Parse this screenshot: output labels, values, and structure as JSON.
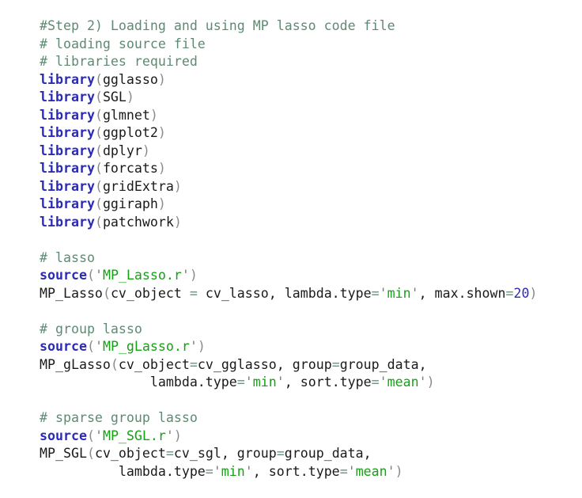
{
  "document": {
    "kind": "r-code-snippet",
    "language": "R",
    "background_color": "#ffffff"
  },
  "colors": {
    "comment": "#5e8a73",
    "keyword": "#2b2bb5",
    "string": "#16a016",
    "quote": "#7a7a7a",
    "paren": "#8a8a8a",
    "plain": "#1a1a1a",
    "number": "#2b2bb5",
    "operator": "#6f8f7f"
  },
  "code": {
    "lines": [
      {
        "id": "line-1",
        "type": "comment",
        "text": "#Step 2) Loading and using MP lasso code file",
        "tokens": [
          {
            "t": "#Step 2) Loading and using MP lasso code file",
            "c": "tok-comment"
          }
        ]
      },
      {
        "id": "line-2",
        "type": "comment",
        "text": "# loading source file",
        "tokens": [
          {
            "t": "# loading source file",
            "c": "tok-comment"
          }
        ]
      },
      {
        "id": "line-3",
        "type": "comment",
        "text": "# libraries required",
        "tokens": [
          {
            "t": "# libraries required",
            "c": "tok-comment"
          }
        ]
      },
      {
        "id": "line-4",
        "type": "code",
        "text": "library(gglasso)",
        "tokens": [
          {
            "t": "library",
            "c": "tok-keyword"
          },
          {
            "t": "(",
            "c": "tok-paren"
          },
          {
            "t": "gglasso",
            "c": "tok-plain"
          },
          {
            "t": ")",
            "c": "tok-paren"
          }
        ]
      },
      {
        "id": "line-5",
        "type": "code",
        "text": "library(SGL)",
        "tokens": [
          {
            "t": "library",
            "c": "tok-keyword"
          },
          {
            "t": "(",
            "c": "tok-paren"
          },
          {
            "t": "SGL",
            "c": "tok-plain"
          },
          {
            "t": ")",
            "c": "tok-paren"
          }
        ]
      },
      {
        "id": "line-6",
        "type": "code",
        "text": "library(glmnet)",
        "tokens": [
          {
            "t": "library",
            "c": "tok-keyword"
          },
          {
            "t": "(",
            "c": "tok-paren"
          },
          {
            "t": "glmnet",
            "c": "tok-plain"
          },
          {
            "t": ")",
            "c": "tok-paren"
          }
        ]
      },
      {
        "id": "line-7",
        "type": "code",
        "text": "library(ggplot2)",
        "tokens": [
          {
            "t": "library",
            "c": "tok-keyword"
          },
          {
            "t": "(",
            "c": "tok-paren"
          },
          {
            "t": "ggplot2",
            "c": "tok-plain"
          },
          {
            "t": ")",
            "c": "tok-paren"
          }
        ]
      },
      {
        "id": "line-8",
        "type": "code",
        "text": "library(dplyr)",
        "tokens": [
          {
            "t": "library",
            "c": "tok-keyword"
          },
          {
            "t": "(",
            "c": "tok-paren"
          },
          {
            "t": "dplyr",
            "c": "tok-plain"
          },
          {
            "t": ")",
            "c": "tok-paren"
          }
        ]
      },
      {
        "id": "line-9",
        "type": "code",
        "text": "library(forcats)",
        "tokens": [
          {
            "t": "library",
            "c": "tok-keyword"
          },
          {
            "t": "(",
            "c": "tok-paren"
          },
          {
            "t": "forcats",
            "c": "tok-plain"
          },
          {
            "t": ")",
            "c": "tok-paren"
          }
        ]
      },
      {
        "id": "line-10",
        "type": "code",
        "text": "library(gridExtra)",
        "tokens": [
          {
            "t": "library",
            "c": "tok-keyword"
          },
          {
            "t": "(",
            "c": "tok-paren"
          },
          {
            "t": "gridExtra",
            "c": "tok-plain"
          },
          {
            "t": ")",
            "c": "tok-paren"
          }
        ]
      },
      {
        "id": "line-11",
        "type": "code",
        "text": "library(ggiraph)",
        "tokens": [
          {
            "t": "library",
            "c": "tok-keyword"
          },
          {
            "t": "(",
            "c": "tok-paren"
          },
          {
            "t": "ggiraph",
            "c": "tok-plain"
          },
          {
            "t": ")",
            "c": "tok-paren"
          }
        ]
      },
      {
        "id": "line-12",
        "type": "code",
        "text": "library(patchwork)",
        "tokens": [
          {
            "t": "library",
            "c": "tok-keyword"
          },
          {
            "t": "(",
            "c": "tok-paren"
          },
          {
            "t": "patchwork",
            "c": "tok-plain"
          },
          {
            "t": ")",
            "c": "tok-paren"
          }
        ]
      },
      {
        "id": "line-13",
        "type": "blank",
        "text": "",
        "tokens": []
      },
      {
        "id": "line-14",
        "type": "comment",
        "text": "# lasso",
        "tokens": [
          {
            "t": "# lasso",
            "c": "tok-comment"
          }
        ]
      },
      {
        "id": "line-15",
        "type": "code",
        "text": "source('MP_Lasso.r')",
        "tokens": [
          {
            "t": "source",
            "c": "tok-keyword"
          },
          {
            "t": "(",
            "c": "tok-paren"
          },
          {
            "t": "'",
            "c": "tok-quote"
          },
          {
            "t": "MP_Lasso.r",
            "c": "tok-string"
          },
          {
            "t": "'",
            "c": "tok-quote"
          },
          {
            "t": ")",
            "c": "tok-paren"
          }
        ]
      },
      {
        "id": "line-16",
        "type": "code",
        "text": "MP_Lasso(cv_object = cv_lasso, lambda.type='min', max.shown=20)",
        "tokens": [
          {
            "t": "MP_Lasso",
            "c": "tok-plain"
          },
          {
            "t": "(",
            "c": "tok-paren"
          },
          {
            "t": "cv_object ",
            "c": "tok-plain"
          },
          {
            "t": "=",
            "c": "tok-op"
          },
          {
            "t": " cv_lasso, lambda.type",
            "c": "tok-plain"
          },
          {
            "t": "=",
            "c": "tok-op"
          },
          {
            "t": "'",
            "c": "tok-quote"
          },
          {
            "t": "min",
            "c": "tok-string"
          },
          {
            "t": "'",
            "c": "tok-quote"
          },
          {
            "t": ", max.shown",
            "c": "tok-plain"
          },
          {
            "t": "=",
            "c": "tok-op"
          },
          {
            "t": "20",
            "c": "tok-number"
          },
          {
            "t": ")",
            "c": "tok-paren"
          }
        ]
      },
      {
        "id": "line-17",
        "type": "blank",
        "text": "",
        "tokens": []
      },
      {
        "id": "line-18",
        "type": "comment",
        "text": "# group lasso",
        "tokens": [
          {
            "t": "# group lasso",
            "c": "tok-comment"
          }
        ]
      },
      {
        "id": "line-19",
        "type": "code",
        "text": "source('MP_gLasso.r')",
        "tokens": [
          {
            "t": "source",
            "c": "tok-keyword"
          },
          {
            "t": "(",
            "c": "tok-paren"
          },
          {
            "t": "'",
            "c": "tok-quote"
          },
          {
            "t": "MP_gLasso.r",
            "c": "tok-string"
          },
          {
            "t": "'",
            "c": "tok-quote"
          },
          {
            "t": ")",
            "c": "tok-paren"
          }
        ]
      },
      {
        "id": "line-20",
        "type": "code",
        "text": "MP_gLasso(cv_object=cv_gglasso, group=group_data,",
        "tokens": [
          {
            "t": "MP_gLasso",
            "c": "tok-plain"
          },
          {
            "t": "(",
            "c": "tok-paren"
          },
          {
            "t": "cv_object",
            "c": "tok-plain"
          },
          {
            "t": "=",
            "c": "tok-op"
          },
          {
            "t": "cv_gglasso, group",
            "c": "tok-plain"
          },
          {
            "t": "=",
            "c": "tok-op"
          },
          {
            "t": "group_data,",
            "c": "tok-plain"
          }
        ]
      },
      {
        "id": "line-21",
        "type": "code",
        "text": "              lambda.type='min', sort.type='mean')",
        "tokens": [
          {
            "t": "              lambda.type",
            "c": "tok-plain"
          },
          {
            "t": "=",
            "c": "tok-op"
          },
          {
            "t": "'",
            "c": "tok-quote"
          },
          {
            "t": "min",
            "c": "tok-string"
          },
          {
            "t": "'",
            "c": "tok-quote"
          },
          {
            "t": ", sort.type",
            "c": "tok-plain"
          },
          {
            "t": "=",
            "c": "tok-op"
          },
          {
            "t": "'",
            "c": "tok-quote"
          },
          {
            "t": "mean",
            "c": "tok-string"
          },
          {
            "t": "'",
            "c": "tok-quote"
          },
          {
            "t": ")",
            "c": "tok-paren"
          }
        ]
      },
      {
        "id": "line-22",
        "type": "blank",
        "text": "",
        "tokens": []
      },
      {
        "id": "line-23",
        "type": "comment",
        "text": "# sparse group lasso",
        "tokens": [
          {
            "t": "# sparse group lasso",
            "c": "tok-comment"
          }
        ]
      },
      {
        "id": "line-24",
        "type": "code",
        "text": "source('MP_SGL.r')",
        "tokens": [
          {
            "t": "source",
            "c": "tok-keyword"
          },
          {
            "t": "(",
            "c": "tok-paren"
          },
          {
            "t": "'",
            "c": "tok-quote"
          },
          {
            "t": "MP_SGL.r",
            "c": "tok-string"
          },
          {
            "t": "'",
            "c": "tok-quote"
          },
          {
            "t": ")",
            "c": "tok-paren"
          }
        ]
      },
      {
        "id": "line-25",
        "type": "code",
        "text": "MP_SGL(cv_object=cv_sgl, group=group_data,",
        "tokens": [
          {
            "t": "MP_SGL",
            "c": "tok-plain"
          },
          {
            "t": "(",
            "c": "tok-paren"
          },
          {
            "t": "cv_object",
            "c": "tok-plain"
          },
          {
            "t": "=",
            "c": "tok-op"
          },
          {
            "t": "cv_sgl, group",
            "c": "tok-plain"
          },
          {
            "t": "=",
            "c": "tok-op"
          },
          {
            "t": "group_data,",
            "c": "tok-plain"
          }
        ]
      },
      {
        "id": "line-26",
        "type": "code",
        "text": "          lambda.type='min', sort.type='mean')",
        "tokens": [
          {
            "t": "          lambda.type",
            "c": "tok-plain"
          },
          {
            "t": "=",
            "c": "tok-op"
          },
          {
            "t": "'",
            "c": "tok-quote"
          },
          {
            "t": "min",
            "c": "tok-string"
          },
          {
            "t": "'",
            "c": "tok-quote"
          },
          {
            "t": ", sort.type",
            "c": "tok-plain"
          },
          {
            "t": "=",
            "c": "tok-op"
          },
          {
            "t": "'",
            "c": "tok-quote"
          },
          {
            "t": "mean",
            "c": "tok-string"
          },
          {
            "t": "'",
            "c": "tok-quote"
          },
          {
            "t": ")",
            "c": "tok-paren"
          }
        ]
      }
    ]
  }
}
